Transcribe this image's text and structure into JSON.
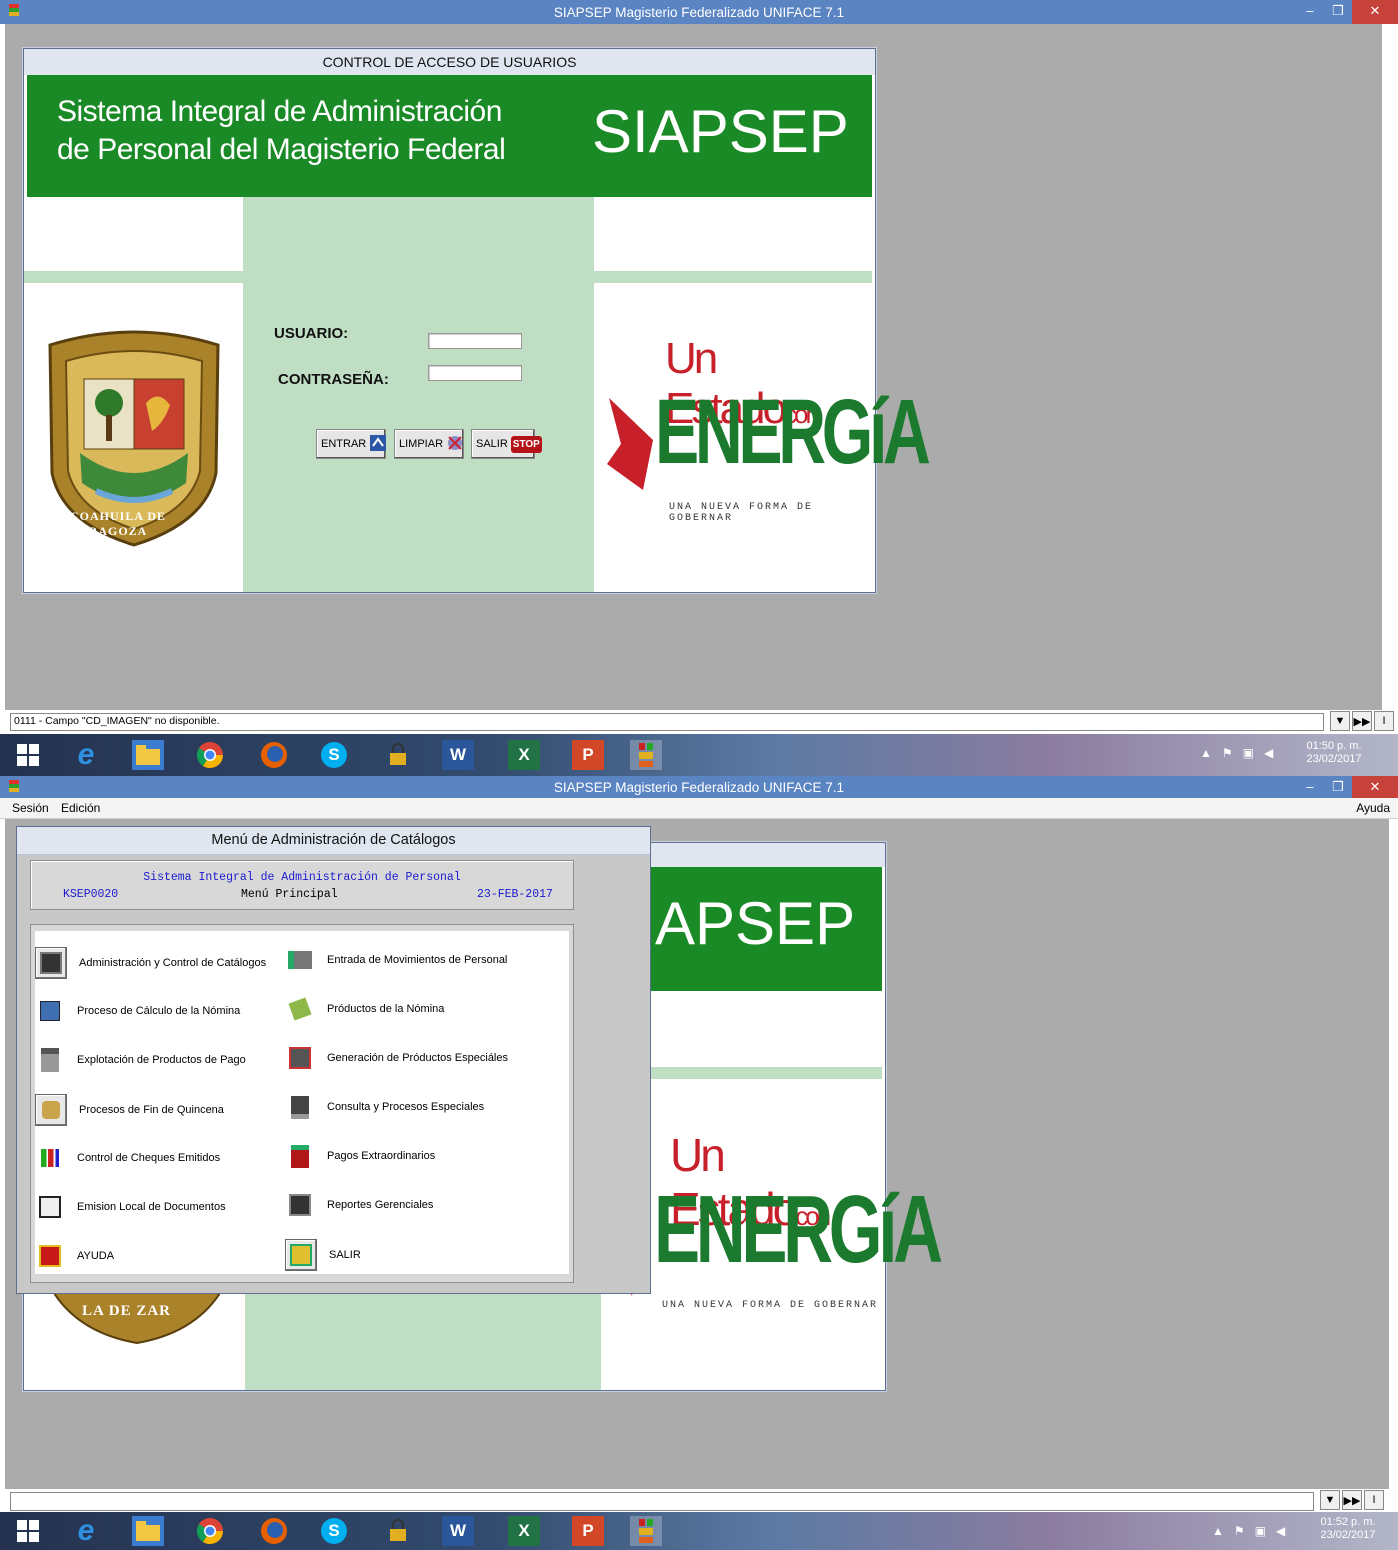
{
  "window1": {
    "title": "SIAPSEP Magisterio Federalizado UNIFACE 7.1",
    "form_title": "CONTROL DE ACCESO DE USUARIOS",
    "banner_line1": "Sistema Integral de Administración",
    "banner_line2": "de Personal del Magisterio Federal",
    "banner_brand": "SIAPSEP",
    "usuario_label": "USUARIO:",
    "password_label": "CONTRASEÑA:",
    "usuario_value": "",
    "password_value": "",
    "btn_entrar": "ENTRAR",
    "btn_limpiar": "LIMPIAR",
    "btn_salir": "SALIR",
    "stop_text": "STOP",
    "seal_text": "COAHUILA DE ZARAGOZA",
    "slogan_line1": "Un Estado",
    "slogan_con": "con",
    "slogan_line2": "ENERGíA",
    "slogan_line3": "UNA NUEVA FORMA DE GOBERNAR",
    "status_text": "0111 - Campo \"CD_IMAGEN\" no disponible.",
    "clock_time": "01:50 p. m.",
    "clock_date": "23/02/2017"
  },
  "window2": {
    "title": "SIAPSEP Magisterio Federalizado UNIFACE 7.1",
    "menubar": {
      "sesion": "Sesión",
      "edicion": "Edición",
      "ayuda": "Ayuda"
    },
    "bg_brand": "APSEP",
    "bg_slogan_line1": "Un Estado",
    "bg_slogan_con": "con",
    "bg_slogan_line2": "ENERGíA",
    "bg_slogan_line3": "UNA NUEVA FORMA DE GOBERNAR",
    "bg_seal_text": "LA DE ZAR",
    "dialog_title": "Menú de Administración de Catálogos",
    "header_line": "Sistema Integral de Administración de Personal",
    "header_code": "KSEP0020",
    "header_menu": "Menú Principal",
    "header_date": "23-FEB-2017",
    "menu_left": [
      "Administración y Control de Catálogos",
      "Proceso de Cálculo de la Nómina",
      "Explotación de Productos de Pago",
      "Procesos de Fin de Quincena",
      "Control de Cheques Emitidos",
      "Emision Local de Documentos",
      "AYUDA"
    ],
    "menu_right": [
      "Entrada de Movimientos de Personal",
      "Próductos de la Nómina",
      "Generación de Próductos Especiáles",
      "Consulta y Procesos Especiales",
      "Pagos Extraordinarios",
      "Reportes Gerenciales",
      "SALIR"
    ],
    "status_text": "",
    "clock_time": "01:52 p. m.",
    "clock_date": "23/02/2017"
  },
  "taskbar_icons": [
    "windows-start-icon",
    "internet-explorer-icon",
    "file-explorer-icon",
    "chrome-icon",
    "firefox-icon",
    "skype-icon",
    "lock-app-icon",
    "word-icon",
    "excel-icon",
    "powerpoint-icon",
    "uniface-icon"
  ],
  "taskbar_glyphs": {
    "word": "W",
    "excel": "X",
    "powerpoint": "P",
    "skype": "S"
  },
  "colors": {
    "banner_green": "#1a8a26",
    "pale_green": "#c0dec4",
    "titlebar_blue": "#5b84c2",
    "slogan_green": "#1b7a2d",
    "slogan_red": "#c8202a",
    "menu_blue_text": "#1b1bd0"
  }
}
